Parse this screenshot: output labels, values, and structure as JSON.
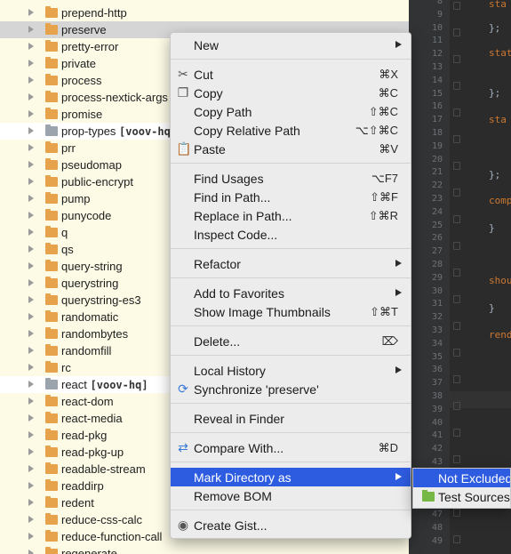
{
  "tree": {
    "items": [
      {
        "label": "prepend-http",
        "tag": ""
      },
      {
        "label": "preserve",
        "tag": ""
      },
      {
        "label": "pretty-error",
        "tag": ""
      },
      {
        "label": "private",
        "tag": ""
      },
      {
        "label": "process",
        "tag": ""
      },
      {
        "label": "process-nextick-args",
        "tag": ""
      },
      {
        "label": "promise",
        "tag": ""
      },
      {
        "label": "prop-types",
        "tag": "[voov-hq]"
      },
      {
        "label": "prr",
        "tag": ""
      },
      {
        "label": "pseudomap",
        "tag": ""
      },
      {
        "label": "public-encrypt",
        "tag": ""
      },
      {
        "label": "pump",
        "tag": ""
      },
      {
        "label": "punycode",
        "tag": ""
      },
      {
        "label": "q",
        "tag": ""
      },
      {
        "label": "qs",
        "tag": ""
      },
      {
        "label": "query-string",
        "tag": ""
      },
      {
        "label": "querystring",
        "tag": ""
      },
      {
        "label": "querystring-es3",
        "tag": ""
      },
      {
        "label": "randomatic",
        "tag": ""
      },
      {
        "label": "randombytes",
        "tag": ""
      },
      {
        "label": "randomfill",
        "tag": ""
      },
      {
        "label": "rc",
        "tag": ""
      },
      {
        "label": "react",
        "tag": "[voov-hq]"
      },
      {
        "label": "react-dom",
        "tag": ""
      },
      {
        "label": "react-media",
        "tag": ""
      },
      {
        "label": "read-pkg",
        "tag": ""
      },
      {
        "label": "read-pkg-up",
        "tag": ""
      },
      {
        "label": "readable-stream",
        "tag": ""
      },
      {
        "label": "readdirp",
        "tag": ""
      },
      {
        "label": "redent",
        "tag": ""
      },
      {
        "label": "reduce-css-calc",
        "tag": ""
      },
      {
        "label": "reduce-function-call",
        "tag": ""
      },
      {
        "label": "regenerate",
        "tag": ""
      }
    ]
  },
  "editor": {
    "line_numbers": [
      "8",
      "9",
      "10",
      "11",
      "12",
      "13",
      "14",
      "15",
      "16",
      "17",
      "18",
      "19",
      "20",
      "21",
      "22",
      "23",
      "24",
      "25",
      "26",
      "27",
      "28",
      "29",
      "30",
      "31",
      "32",
      "33",
      "34",
      "35",
      "36",
      "37",
      "38",
      "39",
      "40",
      "41",
      "42",
      "43",
      "44",
      "45",
      "46",
      "47",
      "48",
      "49"
    ],
    "code": [
      "sta",
      "};",
      "stat",
      "};",
      "sta",
      "};",
      "comp",
      "}",
      "shou",
      "}",
      "rend"
    ]
  },
  "menu": {
    "new": {
      "label": "New"
    },
    "cut": {
      "label": "Cut",
      "shortcut": "⌘X",
      "icon": "scissors-icon"
    },
    "copy": {
      "label": "Copy",
      "shortcut": "⌘C",
      "icon": "copy-icon"
    },
    "copy_path": {
      "label": "Copy Path",
      "shortcut": "⇧⌘C"
    },
    "copy_relative_path": {
      "label": "Copy Relative Path",
      "shortcut": "⌥⇧⌘C"
    },
    "paste": {
      "label": "Paste",
      "shortcut": "⌘V",
      "icon": "paste-icon"
    },
    "find_usages": {
      "label": "Find Usages",
      "shortcut": "⌥F7"
    },
    "find_in_path": {
      "label": "Find in Path...",
      "shortcut": "⇧⌘F"
    },
    "replace_in_path": {
      "label": "Replace in Path...",
      "shortcut": "⇧⌘R"
    },
    "inspect_code": {
      "label": "Inspect Code..."
    },
    "refactor": {
      "label": "Refactor"
    },
    "add_to_favorites": {
      "label": "Add to Favorites"
    },
    "show_image_thumbnails": {
      "label": "Show Image Thumbnails",
      "shortcut": "⇧⌘T"
    },
    "delete": {
      "label": "Delete...",
      "shortcut": "⌦"
    },
    "local_history": {
      "label": "Local History"
    },
    "synchronize": {
      "label": "Synchronize 'preserve'",
      "icon": "sync-icon"
    },
    "reveal_in_finder": {
      "label": "Reveal in Finder"
    },
    "compare_with": {
      "label": "Compare With...",
      "shortcut": "⌘D",
      "icon": "compare-icon"
    },
    "mark_directory_as": {
      "label": "Mark Directory as"
    },
    "remove_bom": {
      "label": "Remove BOM"
    },
    "create_gist": {
      "label": "Create Gist...",
      "icon": "github-icon"
    }
  },
  "submenu": {
    "not_excluded": {
      "label": "Not Excluded"
    },
    "test_sources": {
      "label": "Test Sources Root"
    }
  },
  "colors": {
    "selection": "#2e5ce0",
    "tree_background": "#fdfbe6",
    "folder": "#e6a34b",
    "editor_background": "#2b2b2b"
  }
}
